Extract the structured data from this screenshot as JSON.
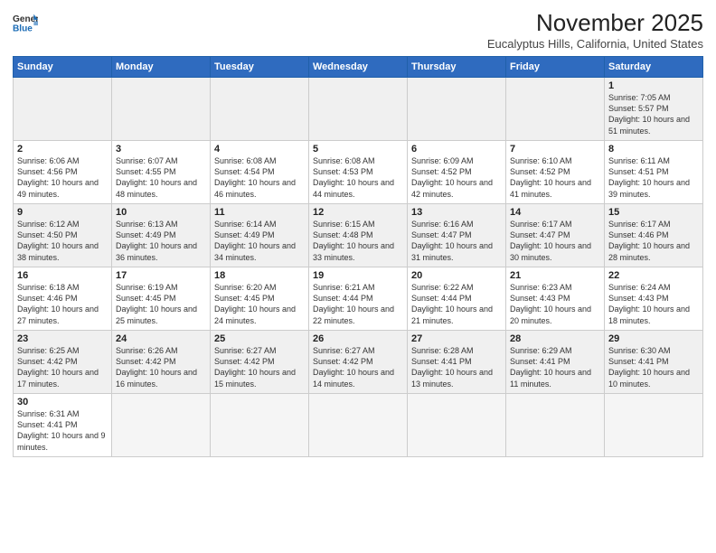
{
  "logo": {
    "line1": "General",
    "line2": "Blue"
  },
  "title": "November 2025",
  "subtitle": "Eucalyptus Hills, California, United States",
  "weekdays": [
    "Sunday",
    "Monday",
    "Tuesday",
    "Wednesday",
    "Thursday",
    "Friday",
    "Saturday"
  ],
  "weeks": [
    [
      {
        "day": "",
        "info": ""
      },
      {
        "day": "",
        "info": ""
      },
      {
        "day": "",
        "info": ""
      },
      {
        "day": "",
        "info": ""
      },
      {
        "day": "",
        "info": ""
      },
      {
        "day": "",
        "info": ""
      },
      {
        "day": "1",
        "info": "Sunrise: 7:05 AM\nSunset: 5:57 PM\nDaylight: 10 hours and 51 minutes."
      }
    ],
    [
      {
        "day": "2",
        "info": "Sunrise: 6:06 AM\nSunset: 4:56 PM\nDaylight: 10 hours and 49 minutes."
      },
      {
        "day": "3",
        "info": "Sunrise: 6:07 AM\nSunset: 4:55 PM\nDaylight: 10 hours and 48 minutes."
      },
      {
        "day": "4",
        "info": "Sunrise: 6:08 AM\nSunset: 4:54 PM\nDaylight: 10 hours and 46 minutes."
      },
      {
        "day": "5",
        "info": "Sunrise: 6:08 AM\nSunset: 4:53 PM\nDaylight: 10 hours and 44 minutes."
      },
      {
        "day": "6",
        "info": "Sunrise: 6:09 AM\nSunset: 4:52 PM\nDaylight: 10 hours and 42 minutes."
      },
      {
        "day": "7",
        "info": "Sunrise: 6:10 AM\nSunset: 4:52 PM\nDaylight: 10 hours and 41 minutes."
      },
      {
        "day": "8",
        "info": "Sunrise: 6:11 AM\nSunset: 4:51 PM\nDaylight: 10 hours and 39 minutes."
      }
    ],
    [
      {
        "day": "9",
        "info": "Sunrise: 6:12 AM\nSunset: 4:50 PM\nDaylight: 10 hours and 38 minutes."
      },
      {
        "day": "10",
        "info": "Sunrise: 6:13 AM\nSunset: 4:49 PM\nDaylight: 10 hours and 36 minutes."
      },
      {
        "day": "11",
        "info": "Sunrise: 6:14 AM\nSunset: 4:49 PM\nDaylight: 10 hours and 34 minutes."
      },
      {
        "day": "12",
        "info": "Sunrise: 6:15 AM\nSunset: 4:48 PM\nDaylight: 10 hours and 33 minutes."
      },
      {
        "day": "13",
        "info": "Sunrise: 6:16 AM\nSunset: 4:47 PM\nDaylight: 10 hours and 31 minutes."
      },
      {
        "day": "14",
        "info": "Sunrise: 6:17 AM\nSunset: 4:47 PM\nDaylight: 10 hours and 30 minutes."
      },
      {
        "day": "15",
        "info": "Sunrise: 6:17 AM\nSunset: 4:46 PM\nDaylight: 10 hours and 28 minutes."
      }
    ],
    [
      {
        "day": "16",
        "info": "Sunrise: 6:18 AM\nSunset: 4:46 PM\nDaylight: 10 hours and 27 minutes."
      },
      {
        "day": "17",
        "info": "Sunrise: 6:19 AM\nSunset: 4:45 PM\nDaylight: 10 hours and 25 minutes."
      },
      {
        "day": "18",
        "info": "Sunrise: 6:20 AM\nSunset: 4:45 PM\nDaylight: 10 hours and 24 minutes."
      },
      {
        "day": "19",
        "info": "Sunrise: 6:21 AM\nSunset: 4:44 PM\nDaylight: 10 hours and 22 minutes."
      },
      {
        "day": "20",
        "info": "Sunrise: 6:22 AM\nSunset: 4:44 PM\nDaylight: 10 hours and 21 minutes."
      },
      {
        "day": "21",
        "info": "Sunrise: 6:23 AM\nSunset: 4:43 PM\nDaylight: 10 hours and 20 minutes."
      },
      {
        "day": "22",
        "info": "Sunrise: 6:24 AM\nSunset: 4:43 PM\nDaylight: 10 hours and 18 minutes."
      }
    ],
    [
      {
        "day": "23",
        "info": "Sunrise: 6:25 AM\nSunset: 4:42 PM\nDaylight: 10 hours and 17 minutes."
      },
      {
        "day": "24",
        "info": "Sunrise: 6:26 AM\nSunset: 4:42 PM\nDaylight: 10 hours and 16 minutes."
      },
      {
        "day": "25",
        "info": "Sunrise: 6:27 AM\nSunset: 4:42 PM\nDaylight: 10 hours and 15 minutes."
      },
      {
        "day": "26",
        "info": "Sunrise: 6:27 AM\nSunset: 4:42 PM\nDaylight: 10 hours and 14 minutes."
      },
      {
        "day": "27",
        "info": "Sunrise: 6:28 AM\nSunset: 4:41 PM\nDaylight: 10 hours and 13 minutes."
      },
      {
        "day": "28",
        "info": "Sunrise: 6:29 AM\nSunset: 4:41 PM\nDaylight: 10 hours and 11 minutes."
      },
      {
        "day": "29",
        "info": "Sunrise: 6:30 AM\nSunset: 4:41 PM\nDaylight: 10 hours and 10 minutes."
      }
    ],
    [
      {
        "day": "30",
        "info": "Sunrise: 6:31 AM\nSunset: 4:41 PM\nDaylight: 10 hours and 9 minutes."
      },
      {
        "day": "",
        "info": ""
      },
      {
        "day": "",
        "info": ""
      },
      {
        "day": "",
        "info": ""
      },
      {
        "day": "",
        "info": ""
      },
      {
        "day": "",
        "info": ""
      },
      {
        "day": "",
        "info": ""
      }
    ]
  ]
}
